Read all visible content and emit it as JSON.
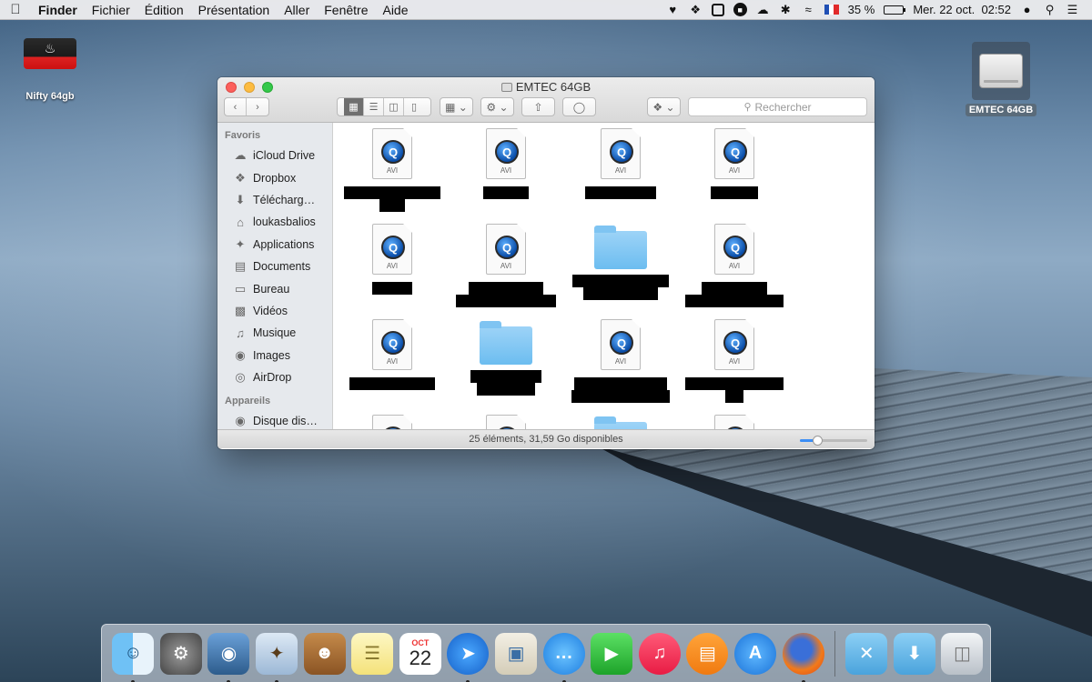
{
  "menubar": {
    "app_name": "Finder",
    "menus": [
      "Fichier",
      "Édition",
      "Présentation",
      "Aller",
      "Fenêtre",
      "Aide"
    ],
    "battery": "35 %",
    "battery_level": 0.35,
    "datetime": "Mer. 22 oct.  02:52"
  },
  "desktop": {
    "nifty_label": "Nifty 64gb",
    "emtec_label": "EMTEC 64GB"
  },
  "finder": {
    "title": "EMTEC 64GB",
    "search_placeholder": "Rechercher",
    "sidebar": {
      "favorites_header": "Favoris",
      "favorites": [
        "iCloud Drive",
        "Dropbox",
        "Télécharg…",
        "loukasbalios",
        "Applications",
        "Documents",
        "Bureau",
        "Vidéos",
        "Musique",
        "Images",
        "AirDrop"
      ],
      "devices_header": "Appareils",
      "devices": [
        "Disque dis…"
      ]
    },
    "file_ext": "AVI",
    "status": "25 éléments, 31,59 Go disponibles",
    "icon_size_level": 0.25
  },
  "dock": {
    "calendar_month": "OCT",
    "calendar_day": "22"
  },
  "colors": {
    "accent": "#3b8ef5",
    "close": "#fc605c",
    "minimize": "#fdbc40",
    "maximize": "#34c84a"
  }
}
